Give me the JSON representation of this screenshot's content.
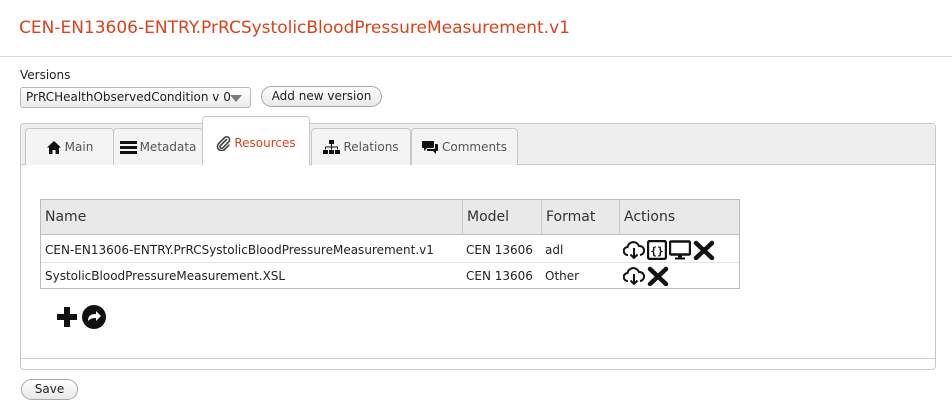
{
  "page_title": "CEN-EN13606-ENTRY.PrRCSystolicBloodPressureMeasurement.v1",
  "versions": {
    "label": "Versions",
    "selected": "PrRCHealthObservedCondition v 0",
    "add_label": "Add new version"
  },
  "tabs": [
    {
      "label": "Main",
      "icon": "home-icon",
      "active": false
    },
    {
      "label": "Metadata",
      "icon": "list-icon",
      "active": false
    },
    {
      "label": "Resources",
      "icon": "paperclip-icon",
      "active": true
    },
    {
      "label": "Relations",
      "icon": "sitemap-icon",
      "active": false
    },
    {
      "label": "Comments",
      "icon": "comments-icon",
      "active": false
    }
  ],
  "resources_table": {
    "columns": [
      "Name",
      "Model",
      "Format",
      "Actions"
    ],
    "rows": [
      {
        "name": "CEN-EN13606-ENTRY.PrRCSystolicBloodPressureMeasurement.v1",
        "model": "CEN 13606",
        "format": "adl",
        "actions": [
          "download-icon",
          "code-icon",
          "display-icon",
          "delete-icon"
        ]
      },
      {
        "name": "SystolicBloodPressureMeasurement.XSL",
        "model": "CEN 13606",
        "format": "Other",
        "actions": [
          "download-icon",
          "delete-icon"
        ]
      }
    ]
  },
  "table_tools": [
    "add-icon",
    "share-icon"
  ],
  "save_label": "Save",
  "colors": {
    "accent": "#d8431b",
    "tabbar": "#eeeeee",
    "table_header": "#e9e9e9"
  }
}
